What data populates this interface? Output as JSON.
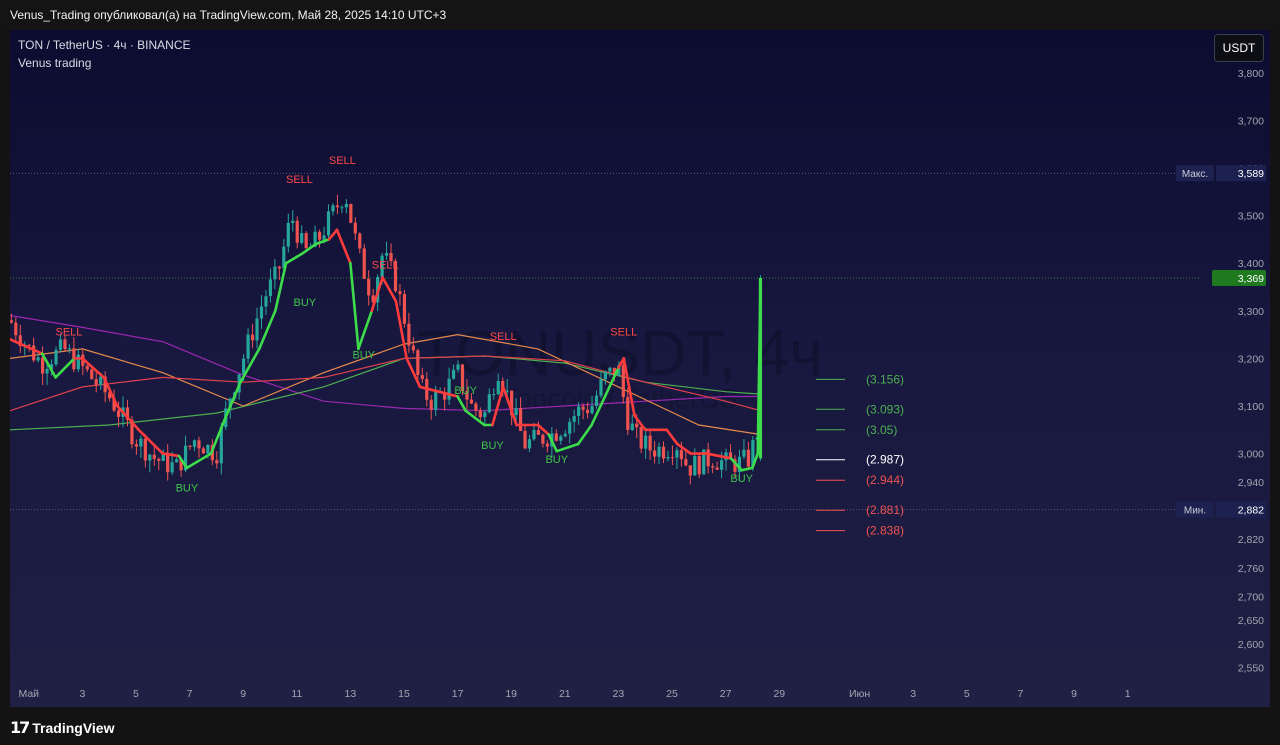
{
  "header": {
    "publisher_line": "Venus_Trading опубликовал(а) на TradingView.com, Май 28, 2025 14:10 UTC+3"
  },
  "legend": {
    "symbol_line": "TON / TetherUS · 4ч · BINANCE",
    "indicator_name": "Venus trading"
  },
  "currency_button": "USDT",
  "watermark": {
    "symbol": "TONUSDT, 4ч",
    "name": "Toncoin / TetherUS"
  },
  "footer": {
    "brand": "TradingView",
    "logo_glyph": "17"
  },
  "colors": {
    "up": "#26a69a",
    "down": "#ef5350",
    "buy_line": "#3ddc4a",
    "sell_line": "#ff3b3b",
    "ma_purple": "#9c27b0",
    "ma_orange": "#e8894a",
    "ma_green": "#4caf50",
    "ma_red": "#e0424b"
  },
  "chart_data": {
    "type": "candlestick",
    "symbol": "TON / TetherUS",
    "timeframe": "4ч",
    "exchange": "BINANCE",
    "y_axis": {
      "ticks": [
        "3,800",
        "3,700",
        "3,600",
        "3,500",
        "3,400",
        "3,300",
        "3,200",
        "3,100",
        "3,000",
        "2,940",
        "2,820",
        "2,760",
        "2,700",
        "2,650",
        "2,600",
        "2,550"
      ],
      "tick_values": [
        3.8,
        3.7,
        3.6,
        3.5,
        3.4,
        3.3,
        3.2,
        3.1,
        3.0,
        2.94,
        2.82,
        2.76,
        2.7,
        2.65,
        2.6,
        2.55
      ],
      "range": [
        2.52,
        3.89
      ]
    },
    "x_axis": {
      "ticks": [
        "Май",
        "3",
        "5",
        "7",
        "9",
        "11",
        "13",
        "15",
        "17",
        "19",
        "21",
        "23",
        "25",
        "27",
        "29",
        "Июн",
        "3",
        "5",
        "7",
        "9",
        "1"
      ],
      "tick_days": [
        1,
        3,
        5,
        7,
        9,
        11,
        13,
        15,
        17,
        19,
        21,
        23,
        25,
        27,
        29,
        32,
        34,
        36,
        38,
        40,
        42
      ],
      "range_days": [
        0.3,
        44.7
      ]
    },
    "high_label": {
      "text": "Макс.",
      "value": "3,589",
      "y": 3.589
    },
    "low_label": {
      "text": "Мин.",
      "value": "2,882",
      "y": 2.882
    },
    "last_price": {
      "value": "3,369",
      "y": 3.369
    },
    "levels": [
      {
        "label": "(3.156)",
        "y": 3.156,
        "color": "#4caf50"
      },
      {
        "label": "(3.093)",
        "y": 3.093,
        "color": "#4caf50"
      },
      {
        "label": "(3.05)",
        "y": 3.05,
        "color": "#4caf50"
      },
      {
        "label": "(2.987)",
        "y": 2.987,
        "color": "#ffffff"
      },
      {
        "label": "(2.944)",
        "y": 2.944,
        "color": "#ef5350"
      },
      {
        "label": "(2.881)",
        "y": 2.881,
        "color": "#ef5350"
      },
      {
        "label": "(2.838)",
        "y": 2.838,
        "color": "#ef5350"
      }
    ],
    "signals": [
      {
        "text": "SELL",
        "day": 11.1,
        "y": 3.56
      },
      {
        "text": "SELL",
        "day": 12.7,
        "y": 3.6
      },
      {
        "text": "SELL",
        "day": 14.3,
        "y": 3.38
      },
      {
        "text": "SELL",
        "day": 2.5,
        "y": 3.24
      },
      {
        "text": "SELL",
        "day": 18.7,
        "y": 3.23
      },
      {
        "text": "SELL",
        "day": 23.2,
        "y": 3.24
      },
      {
        "text": "BUY",
        "day": 11.3,
        "y": 3.335
      },
      {
        "text": "BUY",
        "day": 13.5,
        "y": 3.225
      },
      {
        "text": "BUY",
        "day": 17.3,
        "y": 3.15
      },
      {
        "text": "BUY",
        "day": 18.3,
        "y": 3.035
      },
      {
        "text": "BUY",
        "day": 6.9,
        "y": 2.945
      },
      {
        "text": "BUY",
        "day": 20.7,
        "y": 3.005
      },
      {
        "text": "BUY",
        "day": 27.6,
        "y": 2.965
      }
    ],
    "ohlc_keypoints": [
      [
        0.3,
        3.28
      ],
      [
        1.0,
        3.22
      ],
      [
        1.5,
        3.19
      ],
      [
        2.3,
        3.22
      ],
      [
        3.0,
        3.18
      ],
      [
        4.0,
        3.12
      ],
      [
        5.0,
        3.03
      ],
      [
        5.7,
        2.99
      ],
      [
        6.5,
        2.97
      ],
      [
        7.2,
        3.03
      ],
      [
        8.0,
        3.0
      ],
      [
        8.5,
        3.12
      ],
      [
        9.0,
        3.2
      ],
      [
        9.8,
        3.33
      ],
      [
        10.3,
        3.38
      ],
      [
        10.8,
        3.5
      ],
      [
        11.3,
        3.42
      ],
      [
        11.8,
        3.45
      ],
      [
        12.3,
        3.5
      ],
      [
        12.8,
        3.55
      ],
      [
        13.3,
        3.42
      ],
      [
        13.8,
        3.33
      ],
      [
        14.2,
        3.42
      ],
      [
        14.7,
        3.36
      ],
      [
        15.2,
        3.24
      ],
      [
        15.6,
        3.14
      ],
      [
        16.0,
        3.11
      ],
      [
        16.5,
        3.13
      ],
      [
        17.0,
        3.17
      ],
      [
        17.5,
        3.1
      ],
      [
        18.0,
        3.08
      ],
      [
        18.5,
        3.18
      ],
      [
        19.0,
        3.1
      ],
      [
        19.5,
        3.02
      ],
      [
        20.0,
        3.03
      ],
      [
        20.5,
        3.04
      ],
      [
        21.0,
        3.06
      ],
      [
        21.5,
        3.09
      ],
      [
        22.0,
        3.1
      ],
      [
        22.5,
        3.16
      ],
      [
        23.0,
        3.18
      ],
      [
        23.3,
        3.08
      ],
      [
        23.7,
        3.03
      ],
      [
        24.2,
        3.01
      ],
      [
        24.7,
        3.01
      ],
      [
        25.2,
        3.02
      ],
      [
        25.6,
        2.97
      ],
      [
        26.0,
        2.98
      ],
      [
        26.5,
        2.99
      ],
      [
        27.0,
        2.98
      ],
      [
        27.5,
        2.98
      ],
      [
        27.9,
        2.99
      ],
      [
        28.2,
        3.05
      ],
      [
        28.35,
        3.36
      ]
    ],
    "buy_sell_line": [
      [
        0.3,
        "sell",
        3.24
      ],
      [
        1.5,
        "sell",
        3.21
      ],
      [
        2.0,
        "buy",
        3.16
      ],
      [
        2.7,
        "buy",
        3.2
      ],
      [
        3.0,
        "sell",
        3.2
      ],
      [
        3.8,
        "sell",
        3.16
      ],
      [
        4.3,
        "sell",
        3.1
      ],
      [
        5.1,
        "sell",
        3.05
      ],
      [
        6.0,
        "sell",
        3.0
      ],
      [
        6.6,
        "sell",
        2.995
      ],
      [
        6.9,
        "buy",
        2.97
      ],
      [
        7.8,
        "buy",
        3.0
      ],
      [
        8.3,
        "buy",
        3.07
      ],
      [
        8.9,
        "buy",
        3.15
      ],
      [
        9.6,
        "buy",
        3.22
      ],
      [
        10.2,
        "buy",
        3.3
      ],
      [
        10.6,
        "buy",
        3.4
      ],
      [
        11.2,
        "buy",
        3.42
      ],
      [
        11.7,
        "buy",
        3.44
      ],
      [
        12.2,
        "buy",
        3.45
      ],
      [
        12.5,
        "sell",
        3.47
      ],
      [
        13.0,
        "sell",
        3.4
      ],
      [
        13.3,
        "buy",
        3.22
      ],
      [
        13.8,
        "buy",
        3.3
      ],
      [
        14.2,
        "sell",
        3.37
      ],
      [
        14.7,
        "sell",
        3.32
      ],
      [
        15.1,
        "sell",
        3.2
      ],
      [
        15.6,
        "sell",
        3.14
      ],
      [
        16.3,
        "sell",
        3.13
      ],
      [
        17.0,
        "sell",
        3.12
      ],
      [
        17.3,
        "buy",
        3.09
      ],
      [
        18.0,
        "buy",
        3.06
      ],
      [
        18.3,
        "buy",
        3.06
      ],
      [
        18.7,
        "sell",
        3.14
      ],
      [
        19.2,
        "sell",
        3.06
      ],
      [
        20.0,
        "sell",
        3.06
      ],
      [
        20.4,
        "sell",
        3.04
      ],
      [
        20.7,
        "buy",
        3.005
      ],
      [
        21.5,
        "buy",
        3.02
      ],
      [
        22.0,
        "buy",
        3.06
      ],
      [
        22.5,
        "buy",
        3.12
      ],
      [
        23.0,
        "buy",
        3.18
      ],
      [
        23.2,
        "sell",
        3.2
      ],
      [
        23.6,
        "sell",
        3.08
      ],
      [
        24.0,
        "sell",
        3.05
      ],
      [
        24.8,
        "sell",
        3.05
      ],
      [
        25.2,
        "sell",
        3.02
      ],
      [
        25.7,
        "sell",
        3.0
      ],
      [
        26.3,
        "sell",
        3.0
      ],
      [
        27.2,
        "sell",
        2.99
      ],
      [
        27.6,
        "buy",
        2.965
      ],
      [
        28.0,
        "buy",
        2.97
      ],
      [
        28.2,
        "buy",
        3.0
      ],
      [
        28.3,
        "buy",
        3.36
      ]
    ],
    "moving_averages": [
      {
        "name": "",
        "color": "#9c27b0",
        "points": [
          [
            0.3,
            3.29
          ],
          [
            3,
            3.265
          ],
          [
            6,
            3.235
          ],
          [
            9,
            3.165
          ],
          [
            12,
            3.11
          ],
          [
            15,
            3.095
          ],
          [
            18,
            3.09
          ],
          [
            21,
            3.1
          ],
          [
            24,
            3.11
          ],
          [
            27,
            3.12
          ],
          [
            28.3,
            3.12
          ]
        ]
      },
      {
        "name": "",
        "color": "#4caf50",
        "points": [
          [
            0.3,
            3.05
          ],
          [
            4,
            3.06
          ],
          [
            8,
            3.085
          ],
          [
            12,
            3.14
          ],
          [
            15,
            3.2
          ],
          [
            18,
            3.205
          ],
          [
            21,
            3.19
          ],
          [
            24,
            3.15
          ],
          [
            27,
            3.13
          ],
          [
            28.3,
            3.125
          ]
        ]
      },
      {
        "name": "",
        "color": "#e8894a",
        "points": [
          [
            0.3,
            3.2
          ],
          [
            3,
            3.22
          ],
          [
            6,
            3.17
          ],
          [
            9,
            3.1
          ],
          [
            12,
            3.17
          ],
          [
            15,
            3.23
          ],
          [
            17,
            3.25
          ],
          [
            20,
            3.22
          ],
          [
            23,
            3.14
          ],
          [
            26,
            3.06
          ],
          [
            28.3,
            3.04
          ]
        ]
      },
      {
        "name": "",
        "color": "#e0424b",
        "points": [
          [
            0.3,
            3.09
          ],
          [
            3,
            3.14
          ],
          [
            6,
            3.16
          ],
          [
            9,
            3.15
          ],
          [
            12,
            3.16
          ],
          [
            15,
            3.2
          ],
          [
            18,
            3.205
          ],
          [
            21,
            3.195
          ],
          [
            24,
            3.15
          ],
          [
            27,
            3.11
          ],
          [
            28.3,
            3.09
          ]
        ]
      }
    ]
  }
}
